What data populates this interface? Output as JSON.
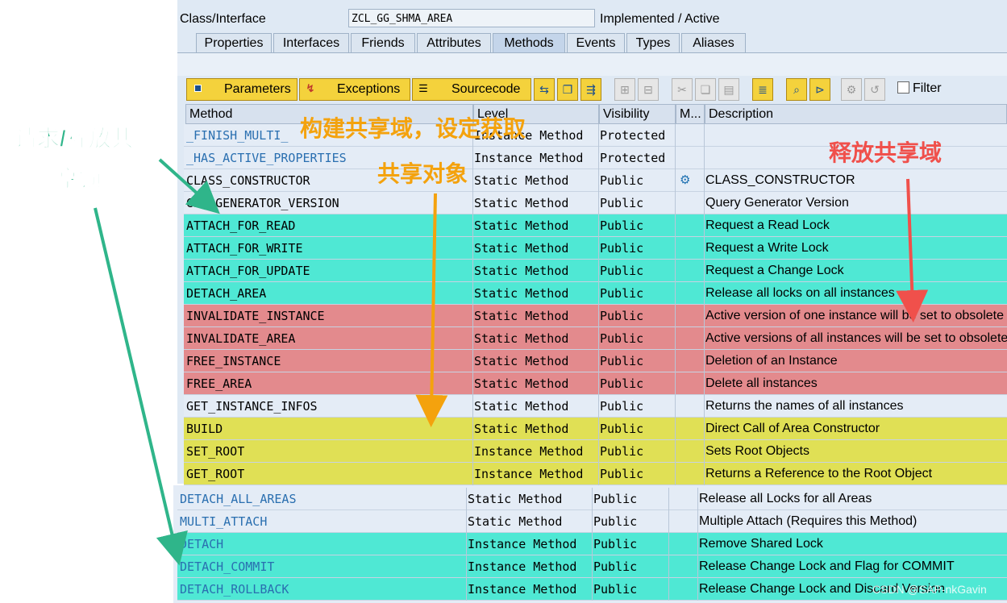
{
  "header": {
    "class_label": "Class/Interface",
    "class_value": "ZCL_GG_SHMA_AREA",
    "status": "Implemented / Active"
  },
  "tabs": [
    "Properties",
    "Interfaces",
    "Friends",
    "Attributes",
    "Methods",
    "Events",
    "Types",
    "Aliases"
  ],
  "active_tab": "Methods",
  "toolbar": {
    "parameters": "Parameters",
    "exceptions": "Exceptions",
    "sourcecode": "Sourcecode",
    "filter": "Filter"
  },
  "columns": {
    "method": "Method",
    "level": "Level",
    "visibility": "Visibility",
    "m": "M...",
    "description": "Description"
  },
  "rows": [
    {
      "method": "_FINISH_MULTI_",
      "level": "Instance Method",
      "visibility": "Protected",
      "desc": "",
      "style": "plain",
      "blue": true
    },
    {
      "method": "_HAS_ACTIVE_PROPERTIES",
      "level": "Instance Method",
      "visibility": "Protected",
      "desc": "",
      "style": "plain",
      "blue": true
    },
    {
      "method": "CLASS_CONSTRUCTOR",
      "level": "Static Method",
      "visibility": "Public",
      "desc": "CLASS_CONSTRUCTOR",
      "style": "plain",
      "blue": false,
      "m_icon": true
    },
    {
      "method": "GET_GENERATOR_VERSION",
      "level": "Static Method",
      "visibility": "Public",
      "desc": "Query Generator Version",
      "style": "plain",
      "blue": false
    },
    {
      "method": "ATTACH_FOR_READ",
      "level": "Static Method",
      "visibility": "Public",
      "desc": "Request a Read Lock",
      "style": "teal",
      "blue": false
    },
    {
      "method": "ATTACH_FOR_WRITE",
      "level": "Static Method",
      "visibility": "Public",
      "desc": "Request a Write Lock",
      "style": "teal",
      "blue": false
    },
    {
      "method": "ATTACH_FOR_UPDATE",
      "level": "Static Method",
      "visibility": "Public",
      "desc": "Request a Change Lock",
      "style": "teal",
      "blue": false
    },
    {
      "method": "DETACH_AREA",
      "level": "Static Method",
      "visibility": "Public",
      "desc": "Release all locks on all instances",
      "style": "teal",
      "blue": false
    },
    {
      "method": "INVALIDATE_INSTANCE",
      "level": "Static Method",
      "visibility": "Public",
      "desc": "Active version of one instance will be set to obsolete",
      "style": "red",
      "blue": false
    },
    {
      "method": "INVALIDATE_AREA",
      "level": "Static Method",
      "visibility": "Public",
      "desc": "Active versions of all instances will be set to obsolete",
      "style": "red",
      "blue": false
    },
    {
      "method": "FREE_INSTANCE",
      "level": "Static Method",
      "visibility": "Public",
      "desc": "Deletion of an Instance",
      "style": "red",
      "blue": false
    },
    {
      "method": "FREE_AREA",
      "level": "Static Method",
      "visibility": "Public",
      "desc": "Delete all instances",
      "style": "red",
      "blue": false
    },
    {
      "method": "GET_INSTANCE_INFOS",
      "level": "Static Method",
      "visibility": "Public",
      "desc": "Returns the names of all instances",
      "style": "plain",
      "blue": false
    },
    {
      "method": "BUILD",
      "level": "Static Method",
      "visibility": "Public",
      "desc": "Direct Call of Area Constructor",
      "style": "yellow",
      "blue": false
    },
    {
      "method": "SET_ROOT",
      "level": "Instance Method",
      "visibility": "Public",
      "desc": "Sets Root Objects",
      "style": "yellow",
      "blue": false
    },
    {
      "method": "GET_ROOT",
      "level": "Instance Method",
      "visibility": "Public",
      "desc": "Returns a Reference to the Root Object",
      "style": "yellow",
      "blue": false
    }
  ],
  "rows_lower": [
    {
      "method": "DETACH_ALL_AREAS",
      "level": "Static Method",
      "visibility": "Public",
      "desc": "Release all Locks for all Areas",
      "style": "plain"
    },
    {
      "method": "MULTI_ATTACH",
      "level": "Static Method",
      "visibility": "Public",
      "desc": "Multiple Attach (Requires this Method)",
      "style": "plain"
    },
    {
      "method": "DETACH",
      "level": "Instance Method",
      "visibility": "Public",
      "desc": "Remove Shared Lock",
      "style": "teal"
    },
    {
      "method": "DETACH_COMMIT",
      "level": "Instance Method",
      "visibility": "Public",
      "desc": "Release Change Lock and Flag for COMMIT",
      "style": "teal"
    },
    {
      "method": "DETACH_ROLLBACK",
      "level": "Instance Method",
      "visibility": "Public",
      "desc": "Release Change Lock and Discard Version",
      "style": "teal"
    }
  ],
  "annotations": {
    "green_line1": "请求/释放共",
    "green_line2": "享锁",
    "orange_line1": "构建共享域，设定获取",
    "orange_line2": "共享对象",
    "red": "释放共享域"
  },
  "watermark": "CSDN @SAP-nkGavin",
  "colors": {
    "teal": "#4fe8d4",
    "red": "#e38a8d",
    "yellow": "#e0e055",
    "plain": "#e4ecf6"
  }
}
